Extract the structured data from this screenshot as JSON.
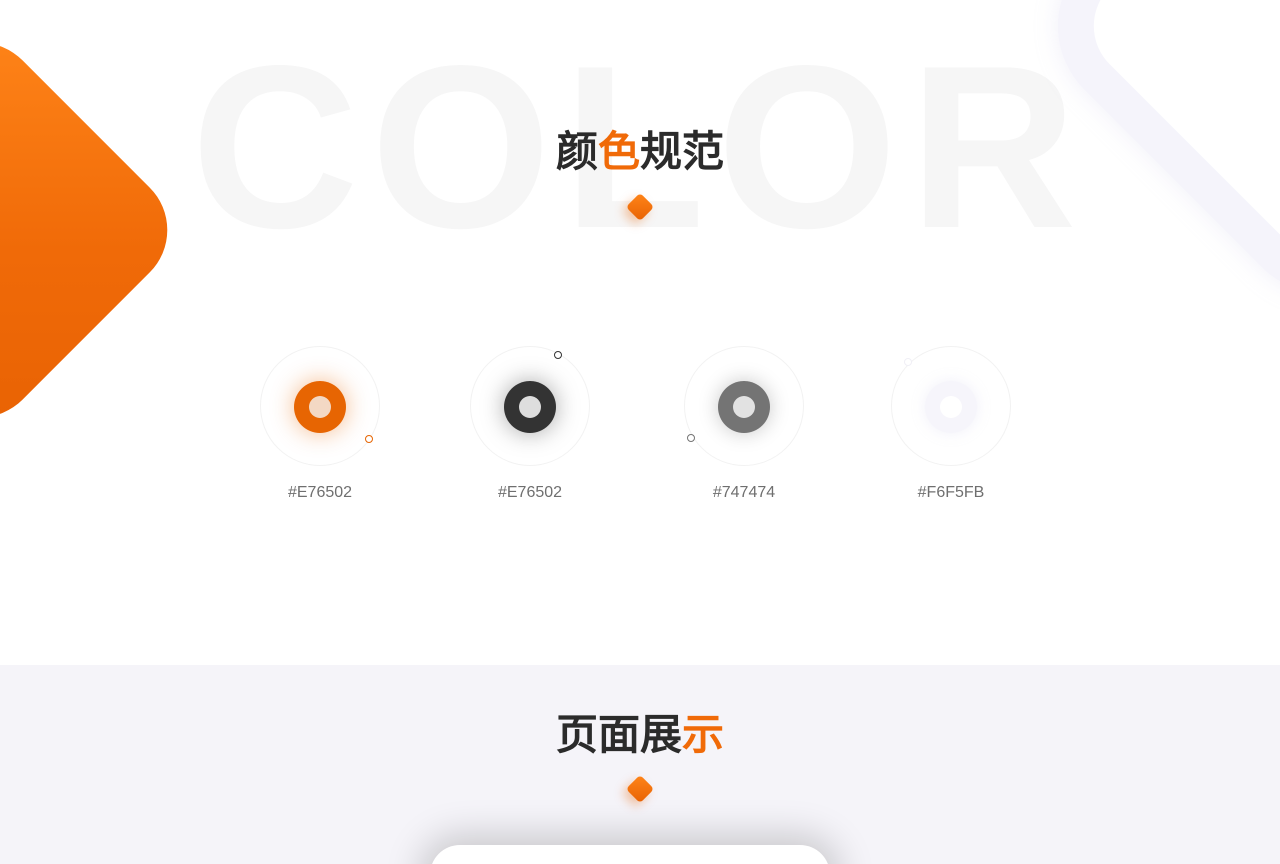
{
  "colors_section": {
    "background_word": "COLOR",
    "title_before": "颜",
    "title_accent": "色",
    "title_after": "规范",
    "accent_color": "#f06a08",
    "swatches": [
      {
        "code": "#E76502",
        "color": "#e76502"
      },
      {
        "code": "#E76502",
        "color": "#333333"
      },
      {
        "code": "#747474",
        "color": "#747474"
      },
      {
        "code": "#F6F5FB",
        "color": "#f6f5fb"
      }
    ]
  },
  "pages_section": {
    "title_before": "页面展",
    "title_accent": "示",
    "background_color": "#f5f4f9"
  }
}
